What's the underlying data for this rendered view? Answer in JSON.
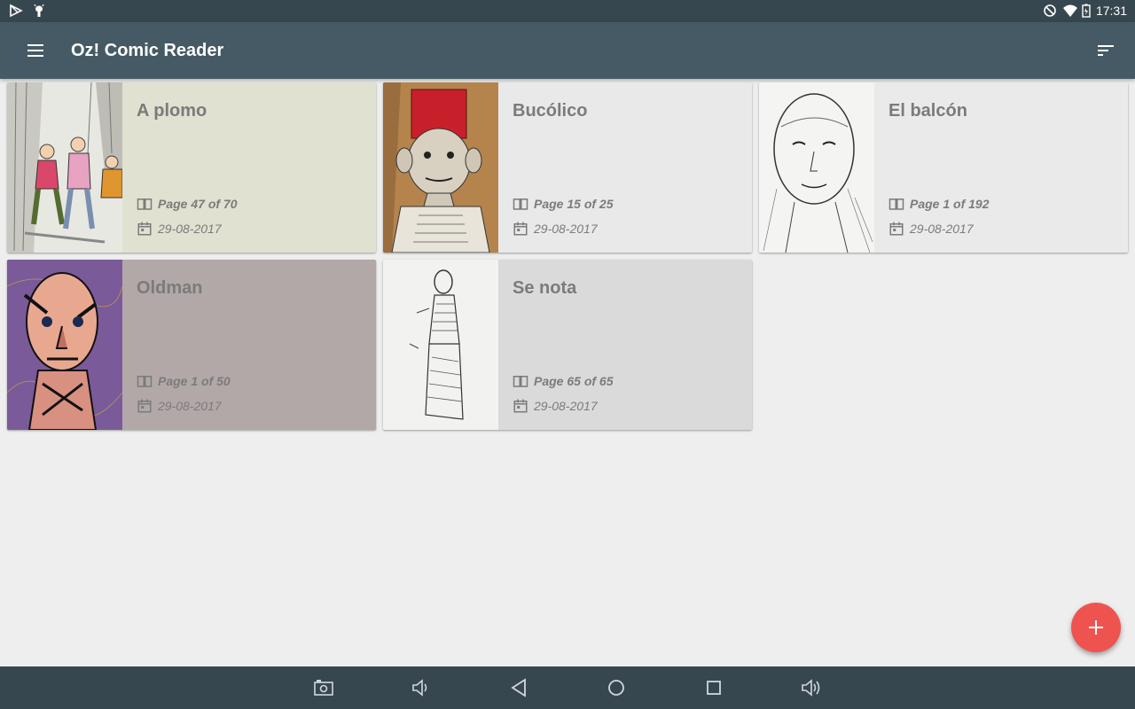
{
  "status_bar": {
    "time": "17:31",
    "left_icons": [
      "play-store-icon",
      "android-debug-icon"
    ],
    "right_icons": [
      "do-not-disturb-icon",
      "wifi-icon",
      "battery-icon"
    ]
  },
  "app_bar": {
    "title": "Oz! Comic Reader",
    "menu_icon": "hamburger-menu-icon",
    "sort_icon": "sort-icon"
  },
  "comics": [
    {
      "title": "A plomo",
      "page": "Page 47 of 70",
      "date": "29-08-2017",
      "background": "#e0e1d0"
    },
    {
      "title": "Bucólico",
      "page": "Page 15 of 25",
      "date": "29-08-2017",
      "background": "#e9e9e9"
    },
    {
      "title": "El balcón",
      "page": "Page 1 of 192",
      "date": "29-08-2017",
      "background": "#eaeaea"
    },
    {
      "title": "Oldman",
      "page": "Page 1 of 50",
      "date": "29-08-2017",
      "background": "#b2a8a8"
    },
    {
      "title": "Se nota",
      "page": "Page 65 of 65",
      "date": "29-08-2017",
      "background": "#dadada"
    }
  ],
  "fab": {
    "icon": "plus-icon",
    "color": "#ef5350"
  },
  "nav_bar": {
    "buttons": [
      "screenshot-icon",
      "volume-down-icon",
      "back-icon",
      "home-icon",
      "recents-icon",
      "volume-up-icon"
    ]
  },
  "colors": {
    "status_bar": "#37474f",
    "app_bar": "#455a64",
    "background": "#eeeeee",
    "text_secondary": "#7b7b7b"
  }
}
